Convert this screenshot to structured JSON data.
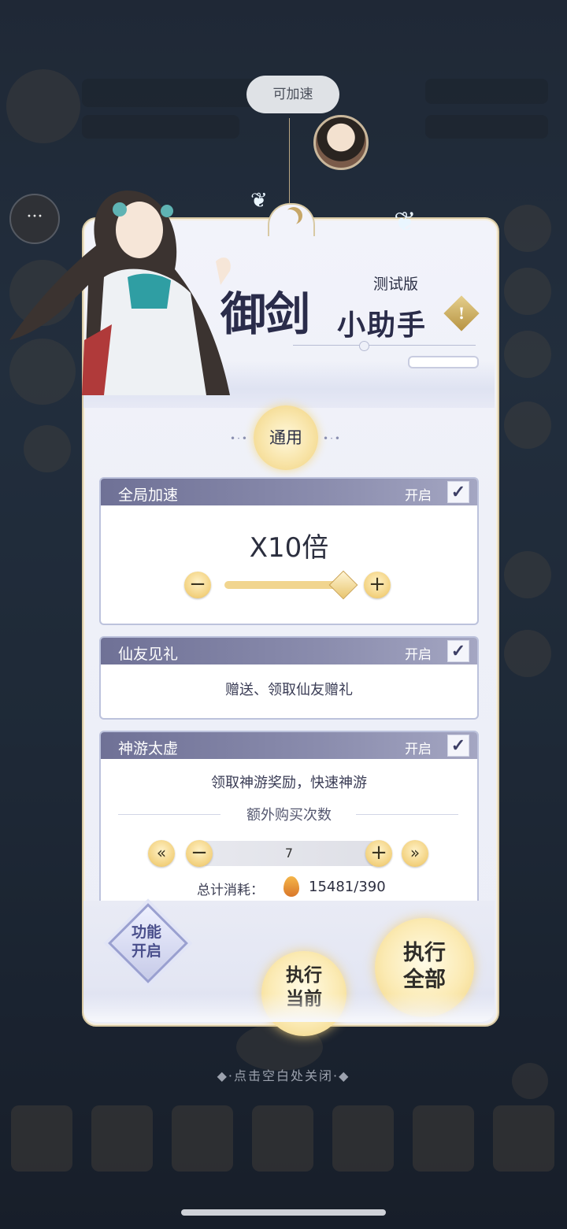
{
  "speech_bubble": "可加速",
  "panel": {
    "version_tag": "测试版",
    "title_main": "御剑",
    "title_sub": "小助手",
    "info_icon": "!",
    "tab_general": "通用"
  },
  "cards": {
    "global_speed": {
      "title": "全局加速",
      "state": "开启",
      "checked": true,
      "value": "X10倍",
      "slider_fraction": 1.0
    },
    "friend_gift": {
      "title": "仙友见礼",
      "state": "开启",
      "checked": true,
      "desc": "赠送、领取仙友赠礼"
    },
    "spirit_travel": {
      "title": "神游太虚",
      "state": "开启",
      "checked": true,
      "desc": "领取神游奖励，快速神游",
      "extra_label": "额外购买次数",
      "count": "7",
      "cost_label": "总计消耗：",
      "cost_value": "15481/390"
    }
  },
  "buttons": {
    "func_open": "功能开启",
    "exec_current": "执行当前",
    "exec_all": "执行全部"
  },
  "close_hint": "点击空白处关闭",
  "colors": {
    "card_header": "#7b7da2",
    "gold": "#f1d27d",
    "panel_bg": "#eef0f8"
  }
}
